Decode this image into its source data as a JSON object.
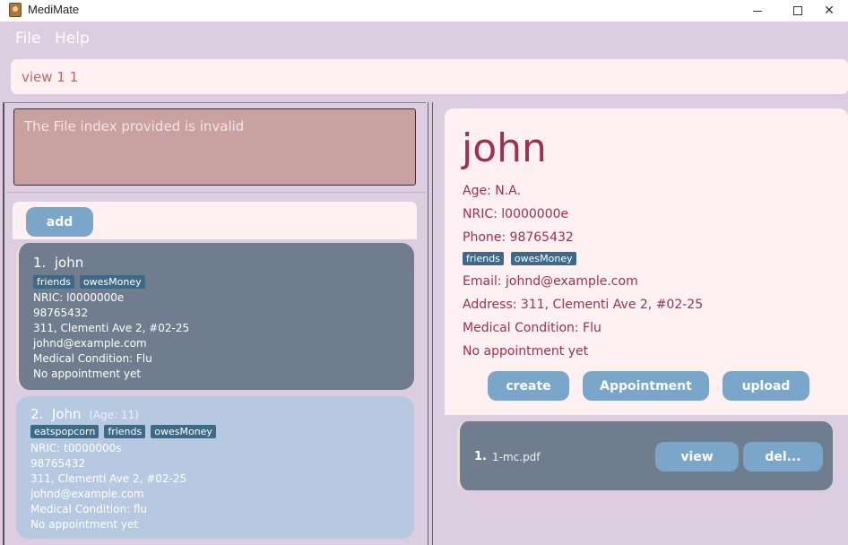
{
  "window": {
    "title": "MediMate"
  },
  "menu": {
    "file": "File",
    "help": "Help"
  },
  "command": {
    "value": "view 1 1"
  },
  "result": {
    "message": "The File index provided is invalid"
  },
  "list": {
    "add_label": "add",
    "persons": [
      {
        "index": "1.",
        "name": "john",
        "age": "",
        "tags": [
          "friends",
          "owesMoney"
        ],
        "nric": "NRIC: l0000000e",
        "phone": "98765432",
        "address": "311, Clementi Ave 2, #02-25",
        "email": "johnd@example.com",
        "condition": "Medical Condition: Flu",
        "appointment": "No appointment yet"
      },
      {
        "index": "2.",
        "name": "John",
        "age": "(Age: 11)",
        "tags": [
          "eatspopcorn",
          "friends",
          "owesMoney"
        ],
        "nric": "NRIC: t0000000s",
        "phone": "98765432",
        "address": "311, Clementi Ave 2, #02-25",
        "email": "johnd@example.com",
        "condition": "Medical Condition: flu",
        "appointment": "No appointment yet"
      }
    ]
  },
  "detail": {
    "name": "john",
    "age": "Age: N.A.",
    "nric": "NRIC: l0000000e",
    "phone": "Phone: 98765432",
    "tags": [
      "friends",
      "owesMoney"
    ],
    "email": "Email: johnd@example.com",
    "address": "Address: 311, Clementi Ave 2, #02-25",
    "condition": "Medical Condition: Flu",
    "appointment": "No appointment yet",
    "buttons": {
      "create": "create",
      "appointment": "Appointment",
      "upload": "upload"
    }
  },
  "files": [
    {
      "index": "1.",
      "name": "1-mc.pdf",
      "view_label": "view",
      "delete_label": "del..."
    }
  ]
}
